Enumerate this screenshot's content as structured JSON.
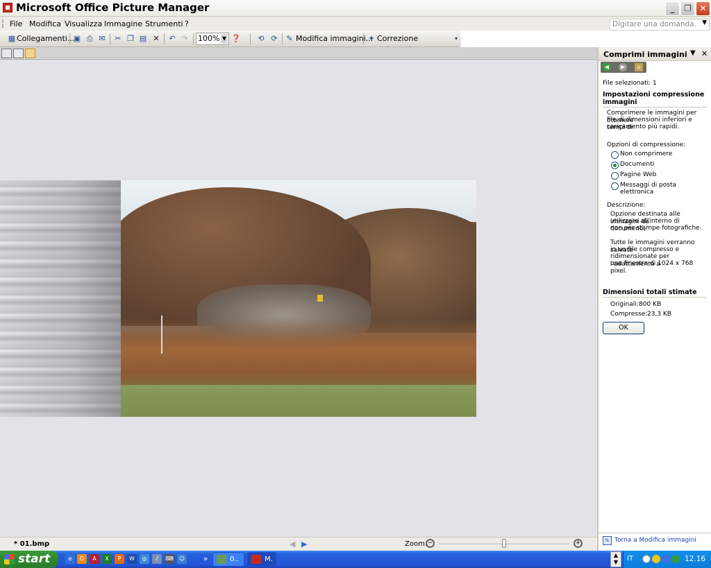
{
  "window": {
    "title": "Microsoft Office Picture Manager",
    "minimize_glyph": "_",
    "restore_glyph": "❐",
    "close_glyph": "✕"
  },
  "menubar": {
    "items": [
      "File",
      "Modifica",
      "Visualizza",
      "Immagine",
      "Strumenti",
      "?"
    ],
    "ask_placeholder": "Digitare una domanda."
  },
  "toolbar": {
    "shortcuts_label": "Collegamenti...",
    "zoom_value": "100%",
    "edit_images_label": "Modifica immagini...",
    "auto_correct_label": "Correzione automatica"
  },
  "statusbar": {
    "filename": "* 01.bmp",
    "zoom_label": "Zoom:",
    "zoom_slider_fraction": 0.5
  },
  "taskpane": {
    "title": "Comprimi immagini",
    "selected_files": "File selezionati: 1",
    "settings_heading": "Impostazioni compressione immagini",
    "intro_lines": [
      "Comprimere le immagini per ottenere",
      "file di dimensioni inferiori e tempi di",
      "caricamento più rapidi."
    ],
    "options_label": "Opzioni di compressione:",
    "options": [
      {
        "label": "Non comprimere",
        "selected": false
      },
      {
        "label": "Documenti",
        "selected": true
      },
      {
        "label": "Pagine Web",
        "selected": false
      },
      {
        "label": "Messaggi di posta elettronica",
        "selected": false
      }
    ],
    "description_label": "Descrizione:",
    "description_lines": [
      "Opzione destinata alle immagini da",
      "utilizzare all'interno di documenti,",
      "non per stampe fotografiche."
    ],
    "note_lines": [
      "Tutte le immagini verranno salvate",
      "in un file compresso e",
      "ridimensionate per l'adattamento a",
      "una finestra di 1024 x 768 pixel."
    ],
    "totals_heading": "Dimensioni totali stimate",
    "original_label": "Originali:",
    "original_value": "800 KB",
    "compressed_label": "Compresse:",
    "compressed_value": "23,3 KB",
    "ok_label": "OK",
    "back_link": "Torna a Modifica immagini"
  },
  "taskbar": {
    "start_label": "start",
    "chevron": "»",
    "tasks": [
      {
        "label": "0..",
        "active": false
      },
      {
        "label": "M.",
        "active": true
      }
    ],
    "language": "IT",
    "clock": "12.16"
  },
  "colors": {
    "xp_blue": "#245edb",
    "start_green": "#2f8b2f",
    "link_blue": "#1a3fb0"
  }
}
